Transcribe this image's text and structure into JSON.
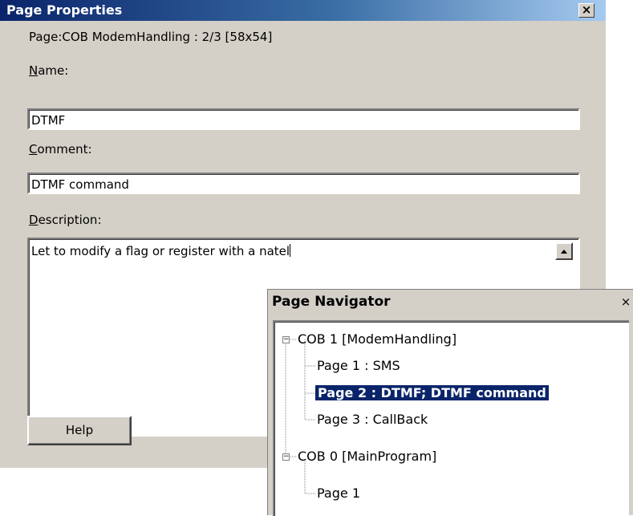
{
  "page_properties": {
    "title": "Page Properties",
    "close_glyph": "×",
    "info": "Page:COB ModemHandling : 2/3 [58x54]",
    "name_label_mnemonic": "N",
    "name_label_rest": "ame:",
    "name_value": "DTMF",
    "comment_label_mnemonic": "C",
    "comment_label_rest": "omment:",
    "comment_value": "DTMF command",
    "description_label_mnemonic": "D",
    "description_label_rest": "escription:",
    "description_value": "Let to modify a flag or register with a natel",
    "help_button": "Help"
  },
  "page_navigator": {
    "title": "Page Navigator",
    "close_glyph": "×",
    "tree": [
      {
        "label": "COB 1 [ModemHandling]",
        "expanded": true,
        "children": [
          {
            "label": "Page 1 : SMS",
            "selected": false
          },
          {
            "label": "Page 2 : DTMF; DTMF command",
            "selected": true
          },
          {
            "label": "Page 3 : CallBack",
            "selected": false
          }
        ]
      },
      {
        "label": "COB 0 [MainProgram]",
        "expanded": true,
        "children": [
          {
            "label": "Page 1",
            "selected": false
          }
        ]
      }
    ],
    "expander_glyph": "−"
  },
  "colors": {
    "title_active": "#0a246a",
    "face": "#d4d0c8",
    "selection": "#0a246a"
  }
}
